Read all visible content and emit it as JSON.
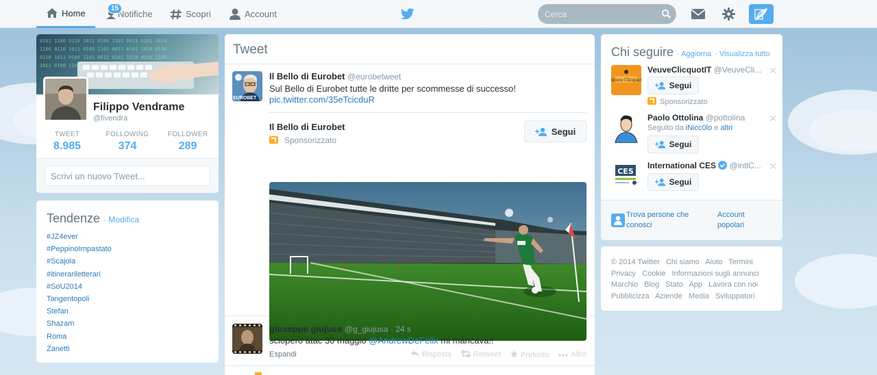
{
  "nav": {
    "home": "Home",
    "notifications": "Notifiche",
    "notifications_count": "15",
    "discover": "Scopri",
    "account": "Account",
    "search_placeholder": "Cerca",
    "accent": "#55acee"
  },
  "profile": {
    "name": "Filippo Vendrame",
    "handle": "@fivendra",
    "stats": [
      {
        "label": "TWEET",
        "value": "8.985"
      },
      {
        "label": "FOLLOWING",
        "value": "374"
      },
      {
        "label": "FOLLOWER",
        "value": "289"
      }
    ],
    "compose_placeholder": "Scrivi un nuovo Tweet..."
  },
  "trends": {
    "title": "Tendenze",
    "edit": "· Modifica",
    "items": [
      "#JZ4ever",
      "#PeppinoImpastato",
      "#Scajola",
      "#itinerariletterari",
      "#SoU2014",
      "Tangentopoli",
      "Stefan",
      "Shazam",
      "Roma",
      "Zanetti"
    ]
  },
  "timeline": {
    "title": "Tweet",
    "tweet1": {
      "name": "Il Bello di Eurobet",
      "handle": "@eurobetweet",
      "text": "Sul Bello di Eurobet tutte le dritte per scommesse di successo!",
      "link": "pic.twitter.com/35eTcicduR",
      "card_title": "Il Bello di Eurobet",
      "sponsored": "Sponsorizzato",
      "follow": "Segui",
      "avatar_label": "EUROBET"
    },
    "tweet2": {
      "name": "giuseppe giujusa",
      "handle": "@g_giujusa",
      "time": "· 24 s",
      "text_before": "sciopero atac 30 maggio ",
      "mention": "@AndrewDeFelix",
      "text_after": " mi mancava!!",
      "expand": "Espandi",
      "actions": [
        "Risposta",
        "Retweet",
        "Preferito",
        "Altro"
      ]
    }
  },
  "who_to_follow": {
    "title": "Chi seguire",
    "refresh": "· Aggiorna",
    "view_all": "· Visualizza tutto",
    "users": [
      {
        "name": "VeuveClicquotIT",
        "handle": "@VeuveCli...",
        "follow": "Segui",
        "note": "Sponsorizzato"
      },
      {
        "name": "Paolo Ottolina",
        "handle": "@pottolina",
        "follow": "Segui",
        "followed_by": "Seguito da",
        "followed_by_user": "iNicc0lo",
        "followed_by_and": "e",
        "followed_by_more": "altri"
      },
      {
        "name": "International CES",
        "handle": "@intlC...",
        "follow": "Segui"
      }
    ],
    "find_people": "Trova persone che conosci",
    "popular": "Account popolari"
  },
  "footer": {
    "links": [
      "© 2014 Twitter",
      "Chi siamo",
      "Aiuto",
      "Termini",
      "Privacy",
      "Cookie",
      "Informazioni sugli annunci",
      "Marchio",
      "Blog",
      "Stato",
      "App",
      "Lavora con noi",
      "Pubblicizza",
      "Aziende",
      "Media",
      "Sviluppatori"
    ]
  }
}
